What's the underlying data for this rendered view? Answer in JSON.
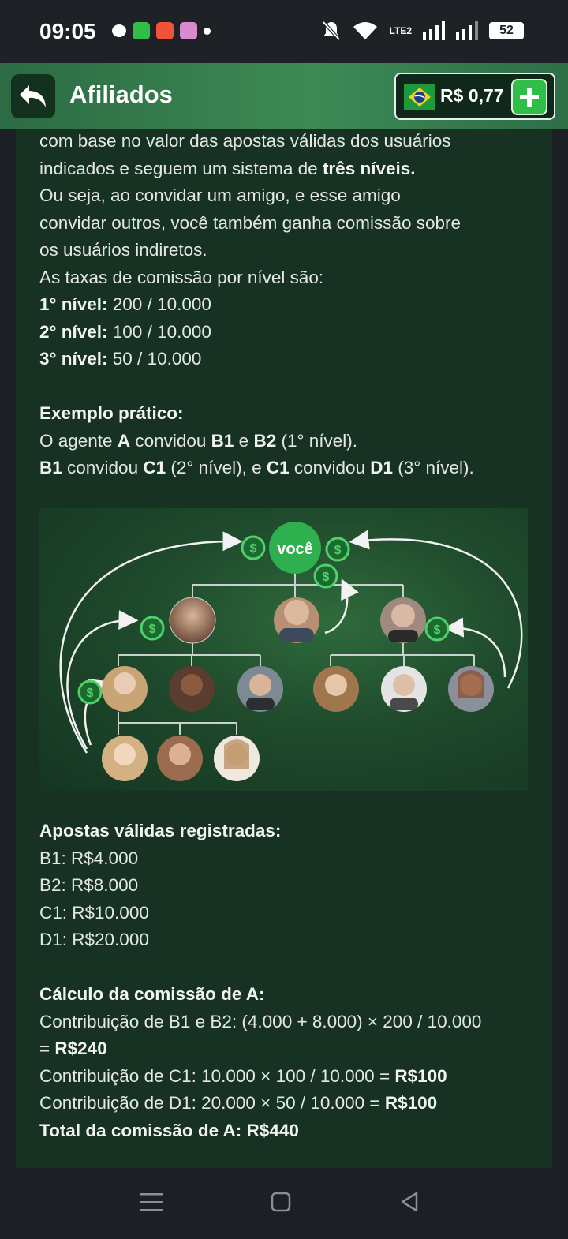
{
  "status_bar": {
    "time": "09:05",
    "battery": "52",
    "network": "LTE2"
  },
  "header": {
    "title": "Afiliados",
    "balance": "R$ 0,77",
    "flag_icon": "brazil-flag-icon",
    "colors": {
      "accent": "#2fbf49",
      "header": "#3d8a55",
      "content_bg": "#173222"
    }
  },
  "content": {
    "intro_line1": "com base no valor das apostas válidas dos usuários",
    "intro_line2a": "indicados e seguem um sistema de ",
    "intro_line2b": "três níveis.",
    "intro_line3": "Ou seja, ao convidar um amigo, e esse amigo",
    "intro_line4": "convidar outros, você também ganha comissão sobre",
    "intro_line5": "os usuários indiretos.",
    "rates_heading": "As taxas de comissão por nível são:",
    "levels": [
      {
        "label": "1° nível:",
        "value": " 200 / 10.000"
      },
      {
        "label": "2° nível:",
        "value": " 100 / 10.000"
      },
      {
        "label": "3° nível:",
        "value": " 50 / 10.000"
      }
    ],
    "example_heading": "Exemplo prático:",
    "example": {
      "l1_a": "O agente ",
      "l1_b": "A",
      "l1_c": " convidou ",
      "l1_d": "B1",
      "l1_e": " e ",
      "l1_f": "B2",
      "l1_g": " (1° nível).",
      "l2_a": "B1",
      "l2_b": " convidou ",
      "l2_c": "C1",
      "l2_d": " (2° nível), e ",
      "l2_e": "C1",
      "l2_f": " convidou ",
      "l2_g": "D1",
      "l2_h": " (3° nível)."
    },
    "diagram": {
      "center_label": "você",
      "coin_symbol": "$"
    },
    "bets_heading": "Apostas válidas registradas:",
    "bets": [
      "B1: R$4.000",
      "B2: R$8.000",
      "C1: R$10.000",
      "D1: R$20.000"
    ],
    "calc_heading": "Cálculo da comissão de A:",
    "calc": {
      "l1": "Contribuição de B1 e B2: (4.000 + 8.000) × 200 / 10.000",
      "l2a": "= ",
      "l2b": "R$240",
      "l3a": "Contribuição de C1: 10.000 × 100 / 10.000 = ",
      "l3b": "R$100",
      "l4a": "Contribuição de D1: 20.000 × 50 / 10.000 = ",
      "l4b": "R$100",
      "total": "Total da comissão de A: R$440"
    }
  }
}
